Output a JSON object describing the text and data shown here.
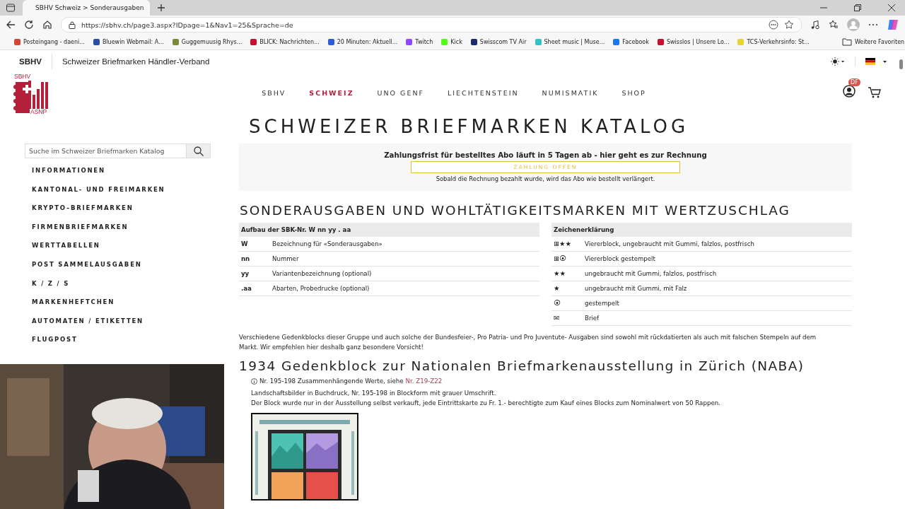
{
  "browser": {
    "tabs": [
      {
        "title": "SBHV Schweiz > Sonderausgaben",
        "selected": true
      }
    ],
    "url": "https://sbhv.ch/page3.aspx?IDpage=1&Nav1=25&Sprache=de",
    "bookmarks": [
      {
        "label": "Posteingang - daeni..."
      },
      {
        "label": "Bluewin Webmail: A..."
      },
      {
        "label": "Guggemuusig Rhys..."
      },
      {
        "label": "BLICK: Nachrichten..."
      },
      {
        "label": "20 Minuten: Aktuell..."
      },
      {
        "label": "Twitch"
      },
      {
        "label": "Kick"
      },
      {
        "label": "Swisscom TV Air"
      },
      {
        "label": "Sheet music | Muse..."
      },
      {
        "label": "Facebook"
      },
      {
        "label": "Swisslos | Unsere Lo..."
      },
      {
        "label": "TCS-Verkehrsinfo: St..."
      }
    ],
    "more_bookmarks": "Weitere Favoriten"
  },
  "site": {
    "brand": "SBHV",
    "name": "Schweizer Briefmarken Händler-Verband",
    "nav": [
      {
        "label": "SBHV",
        "selected": false
      },
      {
        "label": "SCHWEIZ",
        "selected": true
      },
      {
        "label": "UNO GENF",
        "selected": false
      },
      {
        "label": "LIECHTENSTEIN",
        "selected": false
      },
      {
        "label": "NUMISMATIK",
        "selected": false
      },
      {
        "label": "SHOP",
        "selected": false
      }
    ],
    "logo_top": "SBHV",
    "logo_bottom": "ASNP",
    "user_badge": "DF",
    "title": "SCHWEIZER BRIEFMARKEN KATALOG"
  },
  "sidebar": {
    "search": {
      "placeholder": "Suche im Schweizer Briefmarken Katalog"
    },
    "items": [
      "INFORMATIONEN",
      "KANTONAL- UND FREIMARKEN",
      "KRYPTO–BRIEFMARKEN",
      "FIRMENBRIEFMARKEN",
      "WERTTABELLEN",
      "POST SAMMELAUSGABEN",
      "K / Z / S",
      "MARKENHEFTCHEN",
      "AUTOMATEN / ETIKETTEN",
      "FLUGPOST"
    ]
  },
  "notice": {
    "text": "Zahlungsfrist für bestelltes Abo läuft in 5 Tagen ab - hier geht es zur Rechnung",
    "button": "ZAHLUNG OFFEN",
    "note": "Sobald die Rechnung bezahlt wurde, wird das Abo wie bestellt verlängert."
  },
  "section_title": "SONDERAUSGABEN UND WOHLTÄTIGKEITSMARKEN MIT WERTZUSCHLAG",
  "structure_table": {
    "header": "Aufbau der SBK-Nr.  **W nn yy . aa**",
    "rows": [
      {
        "code": "W",
        "description": "Bezeichnung für «Sonderausgaben»"
      },
      {
        "code": "nn",
        "description": "Nummer"
      },
      {
        "code": "yy",
        "description": "Variantenbezeichnung (optional)"
      },
      {
        "code": ".aa",
        "description": "Abarten, Probedrucke (optional)"
      }
    ]
  },
  "legend_table": {
    "header": "Zeichenerklärung",
    "rows": [
      {
        "symbol": "⊞★★",
        "description": "Viererblock, ungebraucht mit Gummi, falzlos, postfrisch"
      },
      {
        "symbol": "⊞⦿",
        "description": "Viererblock gestempelt"
      },
      {
        "symbol": "★★",
        "description": "ungebraucht mit Gummi, falzlos, postfrisch"
      },
      {
        "symbol": "★",
        "description": "ungebraucht mit Gummi, mit Falz"
      },
      {
        "symbol": "⦿",
        "description": "gestempelt"
      },
      {
        "symbol": "✉",
        "description": "Brief"
      }
    ]
  },
  "warning": "Verschiedene Gedenkblocks dieser Gruppe und auch solche der Bundesfeier-, Pro Patria- und Pro Juventute- Ausgaben sind sowohl mit rückdatierten als auch mit falschen Stempeln auf dem Markt. Wir empfehlen hier deshalb ganz besondere Vorsicht!",
  "block": {
    "title": "1934 Gedenkblock zur Nationalen Briefmarkenausstellung in Zürich (NABA)",
    "info": "Nr. 195-198 Zusammenhängende Werte, siehe ",
    "info_link": "Nr. Z19-Z22",
    "lines": [
      "Landschaftsbilder in Buchdruck, Nr. 195-198 in Blockform mit grauer Umschrift.",
      "Der Block wurde nur in der Ausstellung selbst verkauft, jede Eintrittskarte zu Fr. 1.- berechtigte zum Kauf eines Blocks zum Nominalwert von 50 Rappen."
    ]
  }
}
